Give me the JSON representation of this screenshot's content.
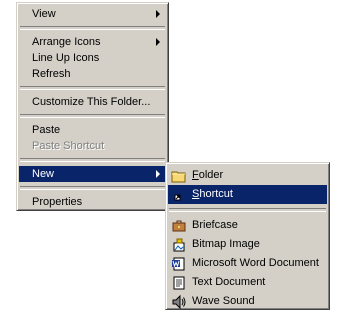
{
  "main_menu": {
    "view": "View",
    "arrange_icons": "Arrange Icons",
    "line_up_icons": "Line Up Icons",
    "refresh": "Refresh",
    "customize_folder": "Customize This Folder...",
    "paste": "Paste",
    "paste_shortcut": "Paste Shortcut",
    "new": "New",
    "properties": "Properties"
  },
  "sub_menu": {
    "folder": {
      "mnemonic": "F",
      "rest": "older"
    },
    "shortcut": {
      "mnemonic": "S",
      "rest": "hortcut"
    },
    "briefcase": "Briefcase",
    "bitmap_image": "Bitmap Image",
    "word_document": "Microsoft Word Document",
    "text_document": "Text Document",
    "wave_sound": "Wave Sound"
  },
  "colors": {
    "menu_bg": "#d4d0c8",
    "highlight": "#0a246a",
    "disabled_text": "#808080"
  }
}
